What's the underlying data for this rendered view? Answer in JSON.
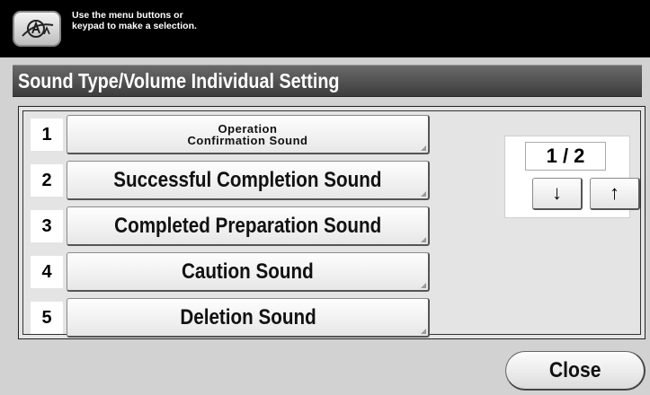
{
  "header": {
    "message_line1": "Use the menu buttons or",
    "message_line2": "keypad to make a selection.",
    "accessibility_icon": "accessibility-icon"
  },
  "title": "Sound Type/Volume Individual Setting",
  "items": [
    {
      "number": "1",
      "label_line1": "Operation",
      "label_line2": "Confirmation Sound"
    },
    {
      "number": "2",
      "label": "Successful Completion Sound"
    },
    {
      "number": "3",
      "label": "Completed Preparation Sound"
    },
    {
      "number": "4",
      "label": "Caution Sound"
    },
    {
      "number": "5",
      "label": "Deletion Sound"
    }
  ],
  "pager": {
    "current_page": 1,
    "total_pages": 2,
    "display": "1 / 2",
    "down_arrow": "↓",
    "up_arrow": "↑"
  },
  "footer": {
    "close_label": "Close"
  }
}
